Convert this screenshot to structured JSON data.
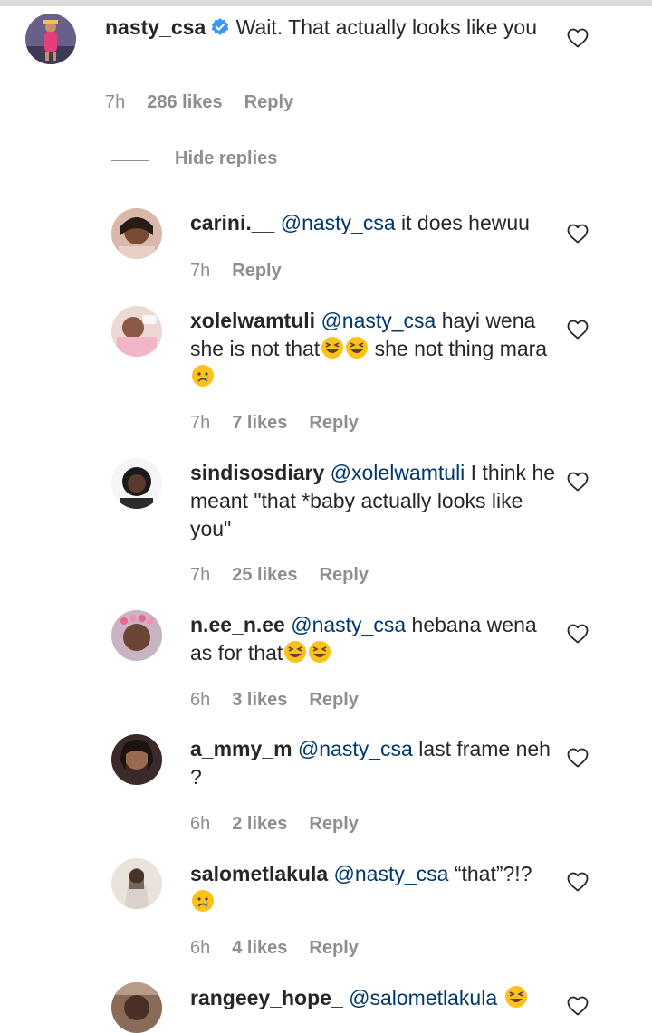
{
  "main_comment": {
    "username": "nasty_csa",
    "verified": true,
    "text": "Wait. That actually looks like you",
    "time": "7h",
    "likes": "286 likes",
    "reply": "Reply"
  },
  "hide_replies_label": "Hide replies",
  "replies": [
    {
      "username": "carini.__",
      "mention": "@nasty_csa",
      "text": " it does hewuu",
      "time": "7h",
      "likes": "",
      "reply": "Reply"
    },
    {
      "username": "xolelwamtuli",
      "mention": "@nasty_csa",
      "text": " hayi wena she is not that",
      "text2": " she not thing mara",
      "time": "7h",
      "likes": "7 likes",
      "reply": "Reply"
    },
    {
      "username": "sindisosdiary",
      "mention": "@xolelwamtuli",
      "text": " I think he meant \"that *baby actually looks like you\"",
      "time": "7h",
      "likes": "25 likes",
      "reply": "Reply"
    },
    {
      "username": "n.ee_n.ee",
      "mention": "@nasty_csa",
      "text": " hebana wena as for that",
      "time": "6h",
      "likes": "3 likes",
      "reply": "Reply"
    },
    {
      "username": "a_mmy_m",
      "mention": "@nasty_csa",
      "text": " last frame neh ?",
      "time": "6h",
      "likes": "2 likes",
      "reply": "Reply"
    },
    {
      "username": "salometlakula",
      "mention": "@nasty_csa",
      "text": " “that”?!?",
      "time": "6h",
      "likes": "4 likes",
      "reply": "Reply"
    },
    {
      "username": "rangeey_hope_",
      "mention": "@salometlakula",
      "text": " ",
      "time": "",
      "likes": "",
      "reply": ""
    }
  ],
  "icons": {
    "heart": "heart-outline-icon",
    "verified": "verified-badge-icon",
    "laugh": "grinning-squinting-emoji",
    "sad": "crying-face-emoji"
  },
  "colors": {
    "text": "#262626",
    "meta": "#8e8e8e",
    "mention": "#00376b",
    "verified": "#3897f0"
  }
}
